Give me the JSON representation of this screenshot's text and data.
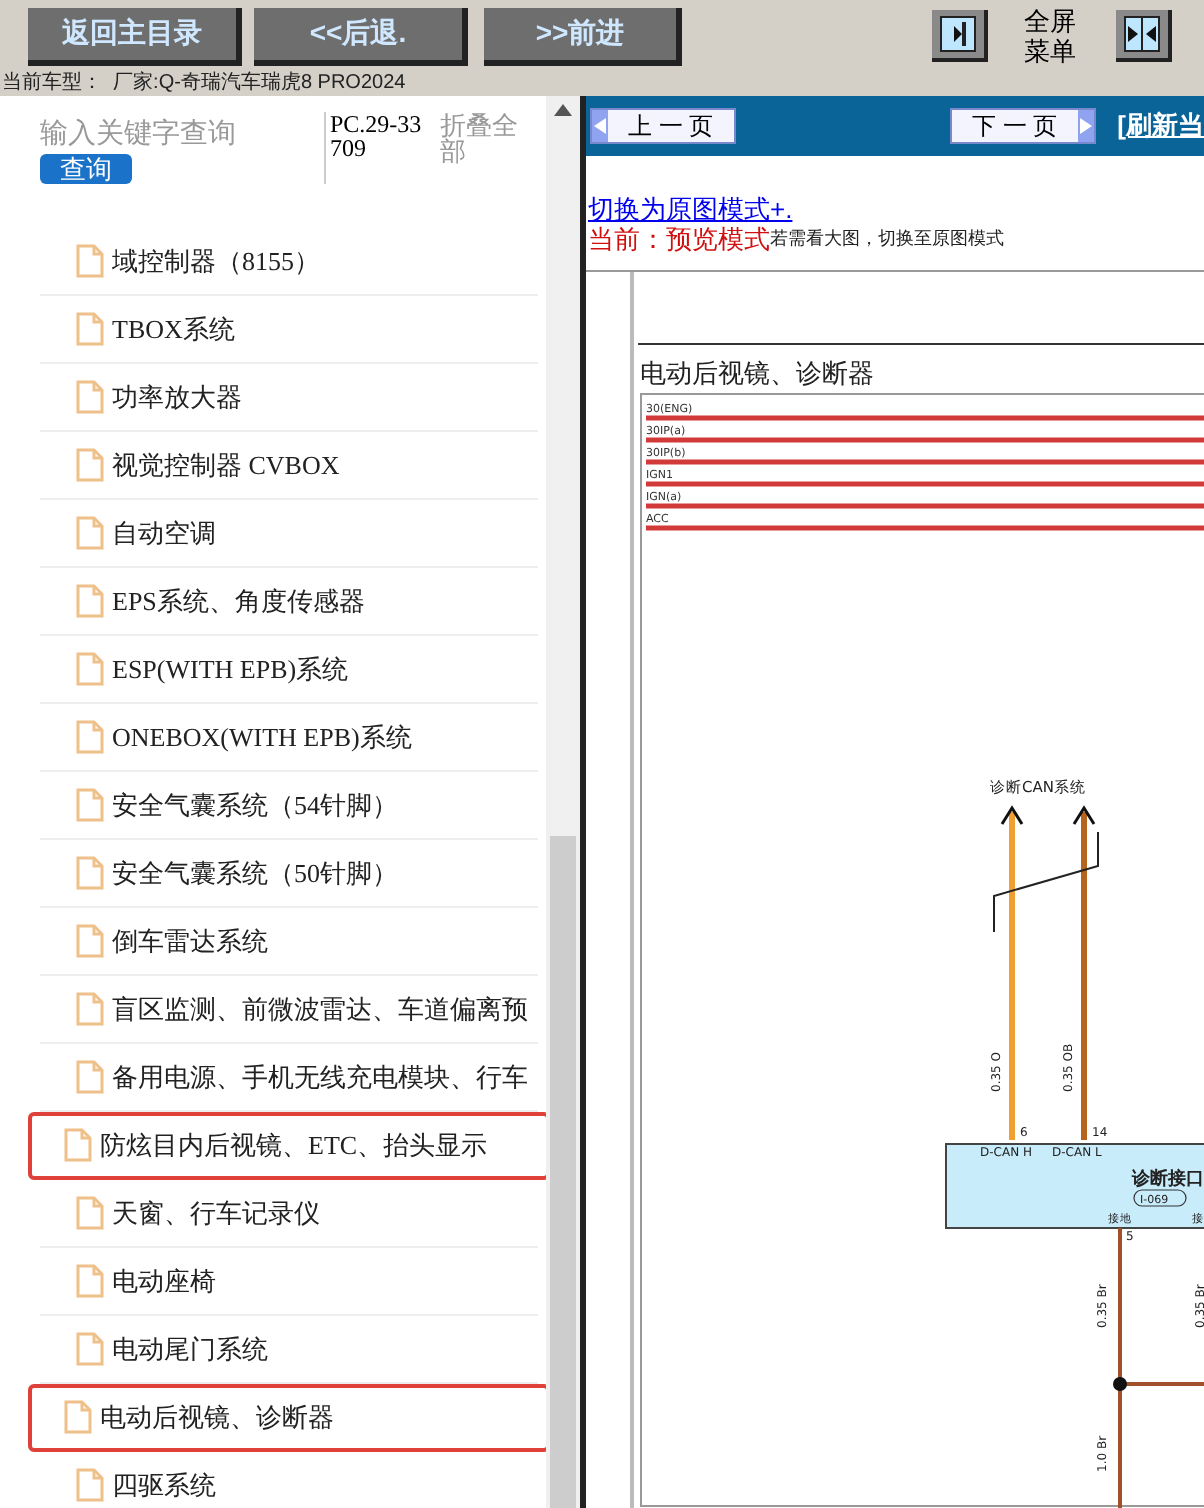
{
  "toolbar": {
    "buttons": [
      "返回主目录",
      "<<后退.",
      ">>前进"
    ],
    "menu_label": "全屏菜单"
  },
  "car_model": "当前车型：  厂家:Q-奇瑞汽车瑞虎8 PRO2024",
  "sidebar": {
    "search": {
      "placeholder": "输入关键字查询",
      "button": "查询"
    },
    "code": "PC.29-33709",
    "collapse": "折叠全部",
    "items": [
      {
        "label": "域控制器（8155）",
        "highlighted": false
      },
      {
        "label": "TBOX系统",
        "highlighted": false
      },
      {
        "label": "功率放大器",
        "highlighted": false
      },
      {
        "label": "视觉控制器 CVBOX",
        "highlighted": false
      },
      {
        "label": "自动空调",
        "highlighted": false
      },
      {
        "label": "EPS系统、角度传感器",
        "highlighted": false
      },
      {
        "label": "ESP(WITH EPB)系统",
        "highlighted": false
      },
      {
        "label": "ONEBOX(WITH EPB)系统",
        "highlighted": false
      },
      {
        "label": "安全气囊系统（54针脚）",
        "highlighted": false
      },
      {
        "label": "安全气囊系统（50针脚）",
        "highlighted": false
      },
      {
        "label": "倒车雷达系统",
        "highlighted": false
      },
      {
        "label": "盲区监测、前微波雷达、车道偏离预",
        "highlighted": false
      },
      {
        "label": "备用电源、手机无线充电模块、行车",
        "highlighted": false
      },
      {
        "label": "防炫目内后视镜、ETC、抬头显示",
        "highlighted": true
      },
      {
        "label": "天窗、行车记录仪",
        "highlighted": false
      },
      {
        "label": "电动座椅",
        "highlighted": false
      },
      {
        "label": "电动尾门系统",
        "highlighted": false
      },
      {
        "label": "电动后视镜、诊断器",
        "highlighted": true
      },
      {
        "label": "四驱系统",
        "highlighted": false
      }
    ]
  },
  "viewer": {
    "prev": "上 一 页",
    "next": "下 一 页",
    "refresh": "[刷新当",
    "mode_link": "切换为原图模式+.",
    "mode_current": "当前：预览模式",
    "mode_hint": "若需看大图，切换至原图模式",
    "diagram": {
      "title": "电动后视镜、诊断器",
      "buses": [
        "30(ENG)",
        "30IP(a)",
        "30IP(b)",
        "IGN1",
        "IGN(a)",
        "ACC"
      ],
      "can_label": "诊断CAN系统",
      "wires": [
        {
          "spec": "0.35 O",
          "pin": "6",
          "signal": "D-CAN H",
          "color": "#f0a030"
        },
        {
          "spec": "0.35 OB",
          "pin": "14",
          "signal": "D-CAN L",
          "color": "#b5651d"
        }
      ],
      "connector": {
        "name": "诊断接口",
        "code": "I-069",
        "ground": "接地",
        "ground_pin": "5",
        "cut_label": "接"
      },
      "ground_wires": [
        "0.35 Br",
        "0.35 Br",
        "1.0 Br"
      ]
    }
  }
}
